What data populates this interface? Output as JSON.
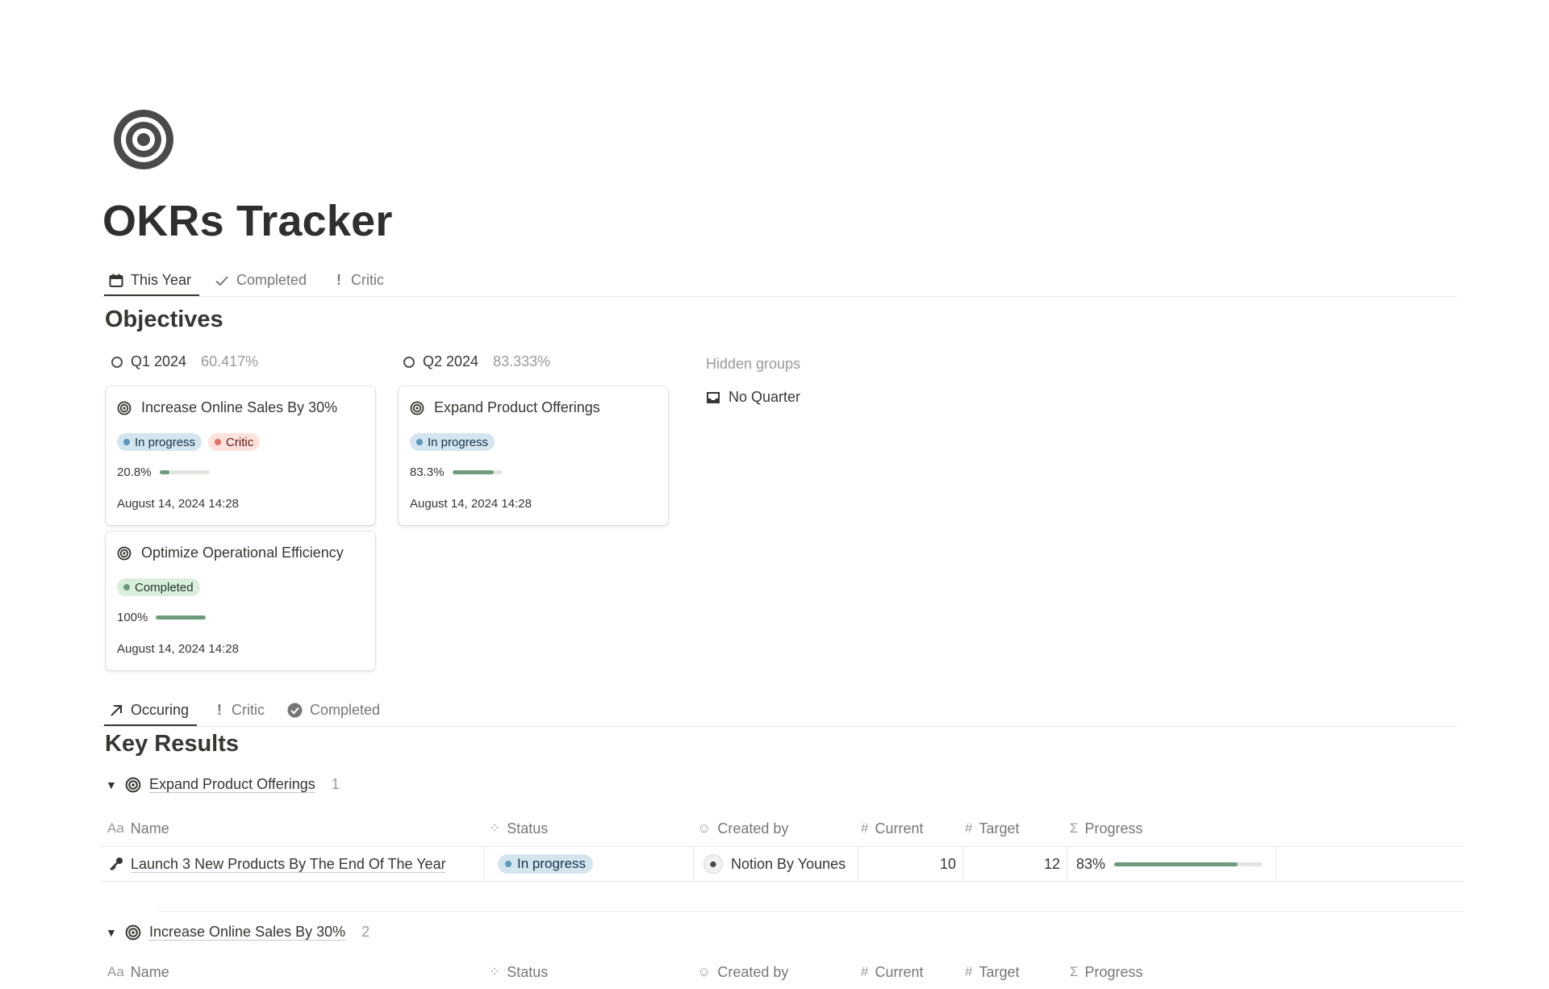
{
  "page": {
    "title": "OKRs Tracker",
    "icon": "target-icon"
  },
  "top_tabs": [
    {
      "label": "This Year",
      "icon": "calendar-icon",
      "active": true
    },
    {
      "label": "Completed",
      "icon": "check-icon",
      "active": false
    },
    {
      "label": "Critic",
      "icon": "exclamation-icon",
      "active": false
    }
  ],
  "objectives": {
    "title": "Objectives",
    "groups": [
      {
        "name": "Q1 2024",
        "percent": "60.417%"
      },
      {
        "name": "Q2 2024",
        "percent": "83.333%"
      }
    ],
    "hidden_label": "Hidden groups",
    "no_quarter_label": "No Quarter",
    "cards": [
      {
        "title": "Increase Online Sales By 30%",
        "tags": [
          "In progress",
          "Critic"
        ],
        "progress_label": "20.8%",
        "progress": 0.208,
        "date": "August 14, 2024 14:28"
      },
      {
        "title": "Optimize Operational Efficiency",
        "tags": [
          "Completed"
        ],
        "progress_label": "100%",
        "progress": 1.0,
        "date": "August 14, 2024 14:28"
      },
      {
        "title": "Expand Product Offerings",
        "tags": [
          "In progress"
        ],
        "progress_label": "83.3%",
        "progress": 0.833,
        "date": "August 14, 2024 14:28"
      }
    ]
  },
  "kr_tabs": [
    {
      "label": "Occuring",
      "icon": "arrow-up-right-icon",
      "active": true
    },
    {
      "label": "Critic",
      "icon": "exclamation-icon",
      "active": false
    },
    {
      "label": "Completed",
      "icon": "check-circle-icon",
      "active": false
    }
  ],
  "key_results": {
    "title": "Key Results",
    "columns": [
      "Name",
      "Status",
      "Created by",
      "Current",
      "Target",
      "Progress"
    ],
    "column_icons": [
      "text-icon",
      "status-icon",
      "person-icon",
      "hash-icon",
      "hash-icon",
      "sigma-icon"
    ],
    "groups": [
      {
        "title": "Expand Product Offerings",
        "count": "1",
        "rows": [
          {
            "name": "Launch 3 New Products By The End Of The Year",
            "status": "In progress",
            "created_by": "Notion By Younes",
            "current": "10",
            "target": "12",
            "progress_label": "83%",
            "progress": 0.83
          }
        ]
      },
      {
        "title": "Increase Online Sales By 30%",
        "count": "2"
      }
    ]
  },
  "colors": {
    "accent_green": "#6c9b7d",
    "blue_tag": "#d3e5ef",
    "red_tag": "#ffe2dd",
    "green_tag": "#dbeddb"
  }
}
